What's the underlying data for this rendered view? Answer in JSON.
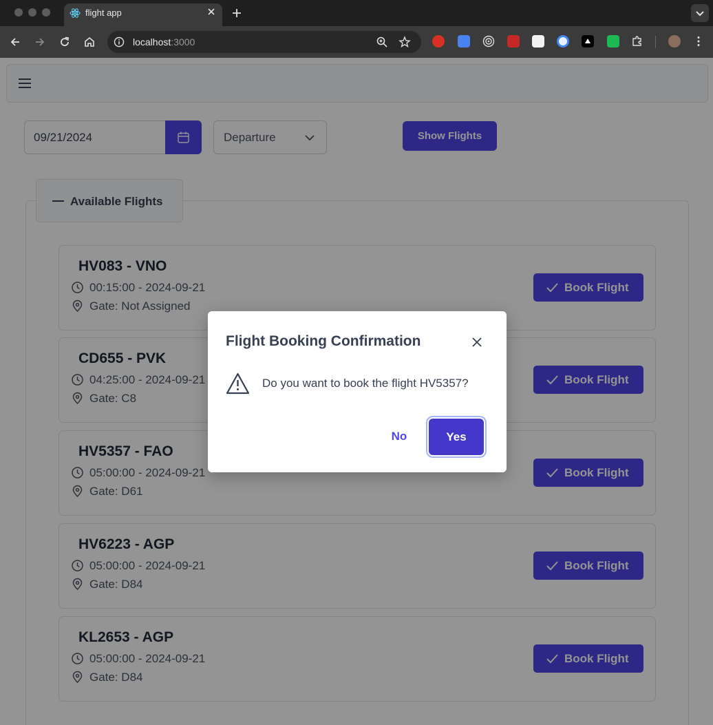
{
  "browser": {
    "tab_title": "flight app",
    "url_host": "localhost",
    "url_port": ":3000"
  },
  "filters": {
    "date_value": "09/21/2024",
    "direction_value": "Departure",
    "show_button_label": "Show Flights"
  },
  "panel": {
    "legend_title": "Available Flights"
  },
  "flights": [
    {
      "title": "HV083 - VNO",
      "time": "00:15:00 - 2024-09-21",
      "gate": "Gate: Not Assigned",
      "button": "Book Flight"
    },
    {
      "title": "CD655 - PVK",
      "time": "04:25:00 - 2024-09-21",
      "gate": "Gate: C8",
      "button": "Book Flight"
    },
    {
      "title": "HV5357 - FAO",
      "time": "05:00:00 - 2024-09-21",
      "gate": "Gate: D61",
      "button": "Book Flight"
    },
    {
      "title": "HV6223 - AGP",
      "time": "05:00:00 - 2024-09-21",
      "gate": "Gate: D84",
      "button": "Book Flight"
    },
    {
      "title": "KL2653 - AGP",
      "time": "05:00:00 - 2024-09-21",
      "gate": "Gate: D84",
      "button": "Book Flight"
    }
  ],
  "dialog": {
    "title": "Flight Booking Confirmation",
    "message": "Do you want to book the flight HV5357?",
    "no_label": "No",
    "yes_label": "Yes"
  },
  "colors": {
    "primary": "#4f46e5",
    "primary_dark": "#4338ca",
    "text": "#374151"
  },
  "icons": {
    "calendar": "calendar-icon",
    "chevron": "chevron-down-icon",
    "clock": "clock-icon",
    "pin": "map-pin-icon",
    "check": "check-icon",
    "warning": "warning-triangle-icon",
    "close": "close-icon"
  }
}
